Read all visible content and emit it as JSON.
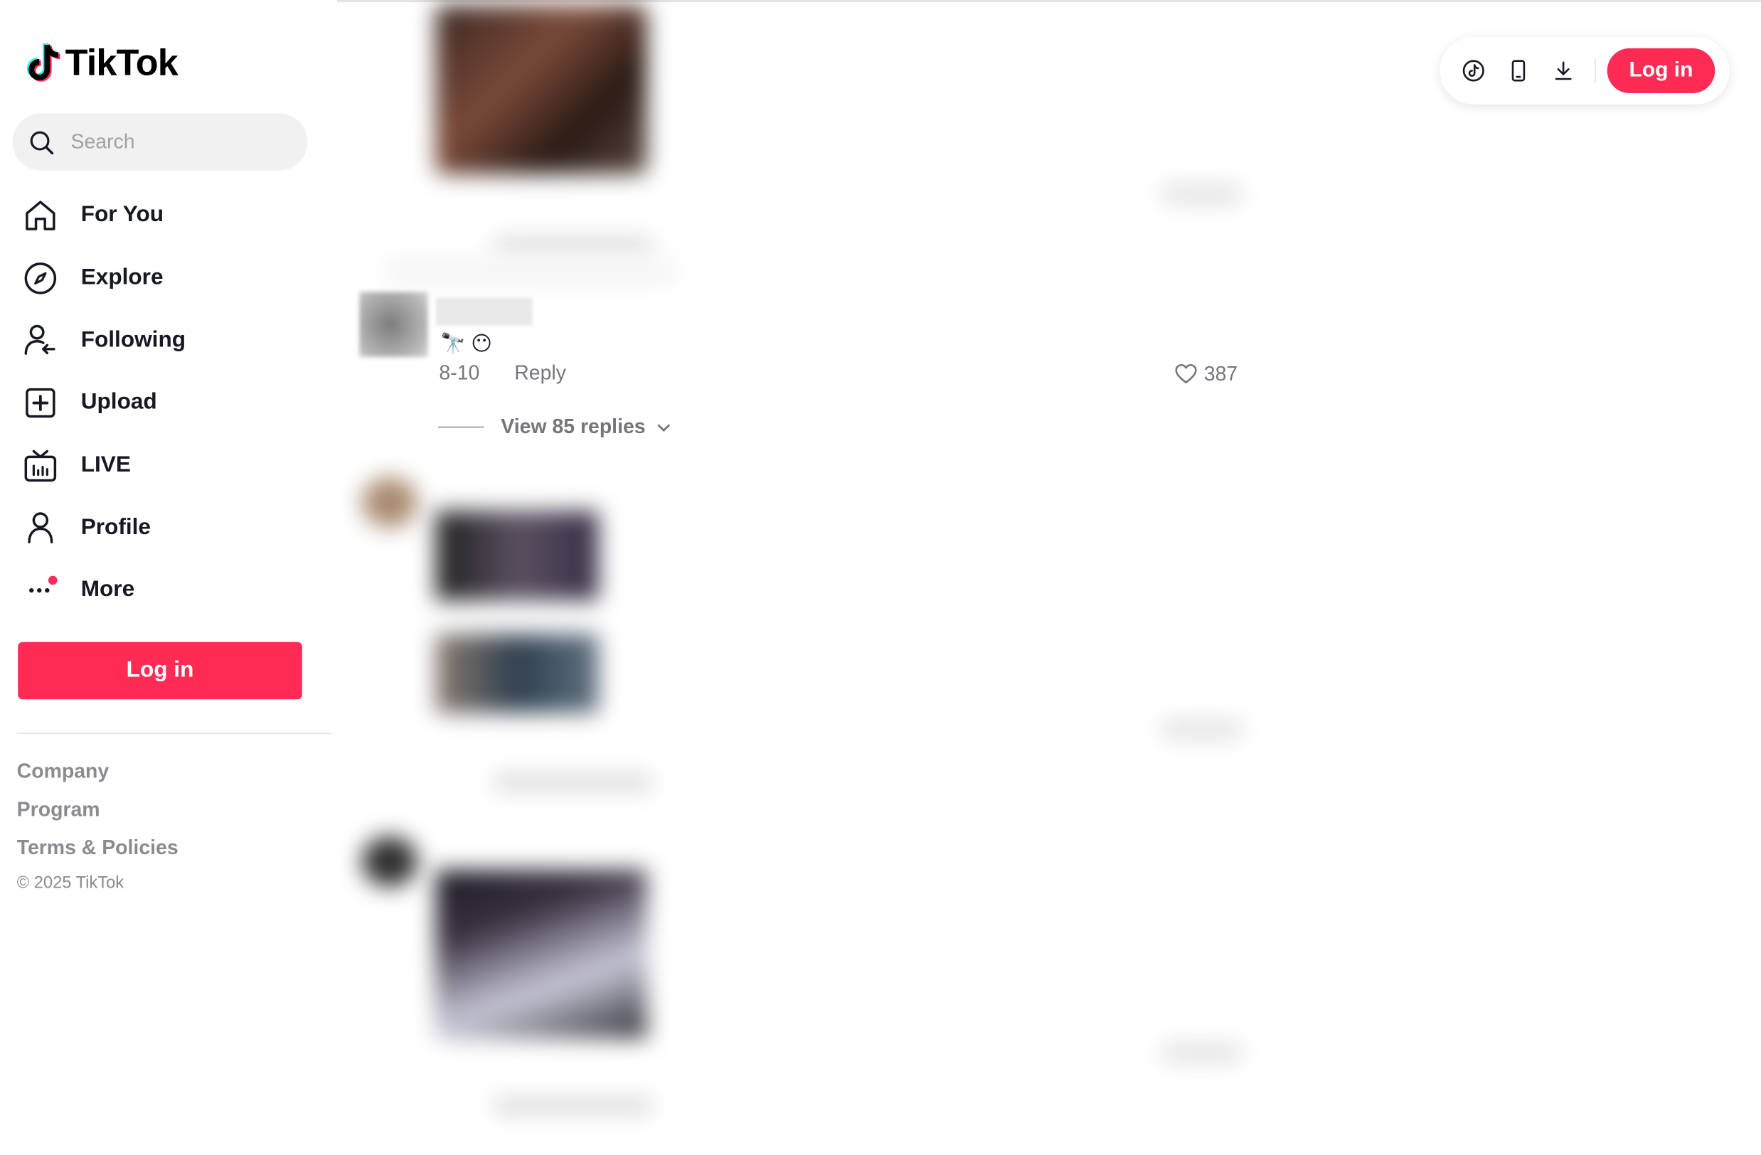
{
  "brand": {
    "name": "TikTok"
  },
  "search": {
    "placeholder": "Search"
  },
  "nav": {
    "items": [
      {
        "label": "For You",
        "icon": "home-icon"
      },
      {
        "label": "Explore",
        "icon": "compass-icon"
      },
      {
        "label": "Following",
        "icon": "following-icon"
      },
      {
        "label": "Upload",
        "icon": "upload-icon"
      },
      {
        "label": "LIVE",
        "icon": "live-icon"
      },
      {
        "label": "Profile",
        "icon": "profile-icon"
      },
      {
        "label": "More",
        "icon": "more-icon"
      }
    ]
  },
  "sidebar": {
    "login_label": "Log in"
  },
  "footer": {
    "links": [
      "Company",
      "Program",
      "Terms & Policies"
    ],
    "copyright": "© 2025 TikTok"
  },
  "comment": {
    "text": "🔭 😶",
    "date": "8-10",
    "reply_label": "Reply",
    "likes": "387",
    "view_replies": "View 85 replies"
  },
  "topbar": {
    "login_label": "Log in"
  },
  "colors": {
    "accent": "#fe2c55",
    "text": "#161823",
    "muted": "#75767c"
  }
}
